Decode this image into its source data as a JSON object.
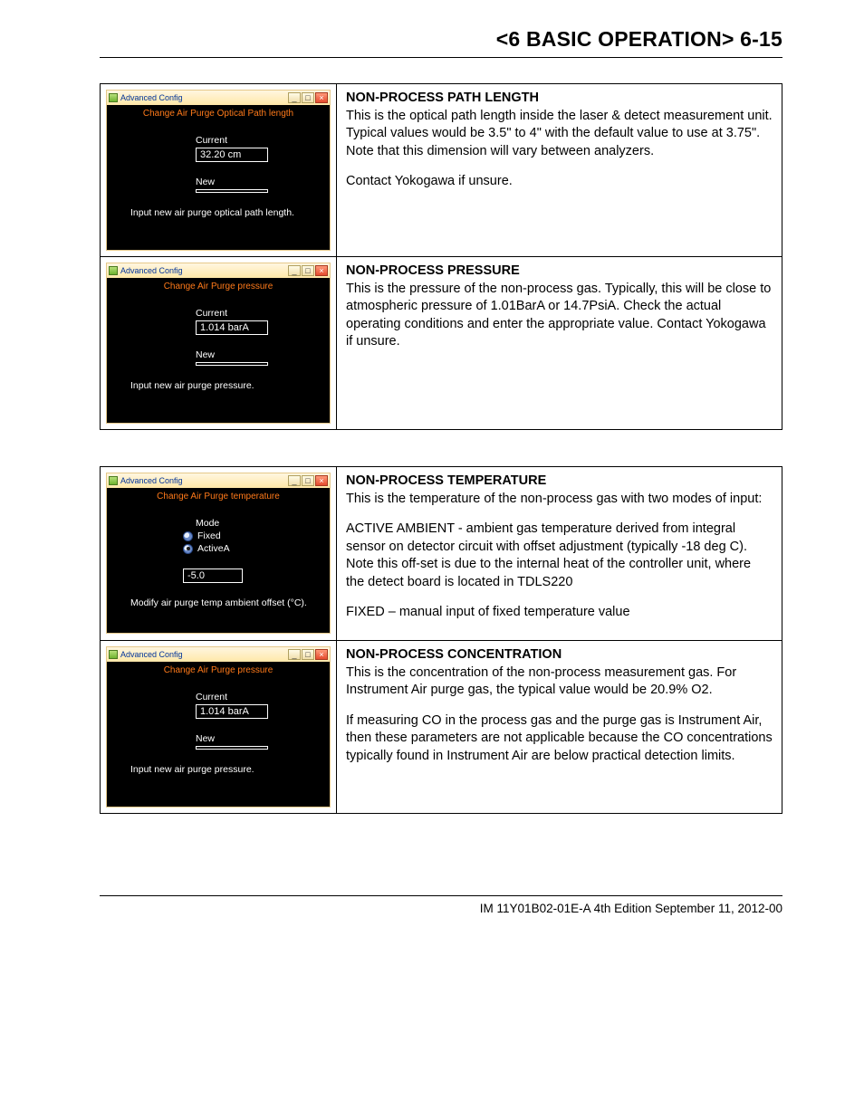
{
  "header": "<6 BASIC OPERATION>  6-15",
  "footer": "IM 11Y01B02-01E-A  4th Edition September 11, 2012-00",
  "win_common": {
    "title": "Advanced Config",
    "min": "_",
    "max": "□",
    "close": "×"
  },
  "rows": [
    {
      "shot": {
        "subtitle": "Change Air Purge Optical Path length",
        "current_label": "Current",
        "current_value": "32.20 cm",
        "new_label": "New",
        "new_value": "",
        "instruction": "Input new air purge optical path length."
      },
      "desc": {
        "title": "Non-Process Path Length",
        "body": "This is the optical path length inside the laser & detect measurement unit. Typical values would be 3.5\" to 4\" with the default value to use at 3.75\". Note that this dimension will vary between analyzers.",
        "body2": "Contact Yokogawa if unsure."
      }
    },
    {
      "shot": {
        "subtitle": "Change Air Purge pressure",
        "current_label": "Current",
        "current_value": "1.014 barA",
        "new_label": "New",
        "new_value": "",
        "instruction": "Input new air purge pressure."
      },
      "desc": {
        "title": "Non-Process Pressure",
        "body": "This is the pressure of the non-process gas. Typically, this will be close to atmospheric pressure of 1.01BarA or 14.7PsiA. Check the actual operating conditions and enter the appropriate value.  Contact Yokogawa if unsure."
      }
    },
    {
      "shot": {
        "subtitle": "Change Air Purge temperature",
        "mode_label": "Mode",
        "opt_fixed": "Fixed",
        "opt_active": "ActiveA",
        "value": "-5.0",
        "instruction": "Modify air purge temp ambient offset (°C)."
      },
      "desc": {
        "title": "Non-Process Temperature",
        "body": "This is the temperature of the non-process gas with two modes of input:",
        "body2": "ACTIVE AMBIENT - ambient gas temperature derived from integral sensor on detector circuit with offset adjustment (typically -18 deg C). Note this off-set is due to the internal heat of the controller unit, where the detect board is located in TDLS220",
        "body3": "FIXED – manual input of fixed temperature value"
      }
    },
    {
      "shot": {
        "subtitle": "Change Air Purge pressure",
        "current_label": "Current",
        "current_value": "1.014 barA",
        "new_label": "New",
        "new_value": "",
        "instruction": "Input new air purge pressure."
      },
      "desc": {
        "title": "Non-Process Concentration",
        "body": "This is the concentration of the non-process measurement gas. For Instrument Air purge gas, the typical value would be 20.9% O2.",
        "body2": "If measuring CO in the process gas and the purge gas is Instrument Air, then these parameters are not applicable because the CO concentrations typically found in Instrument Air are below practical detection limits."
      }
    }
  ]
}
